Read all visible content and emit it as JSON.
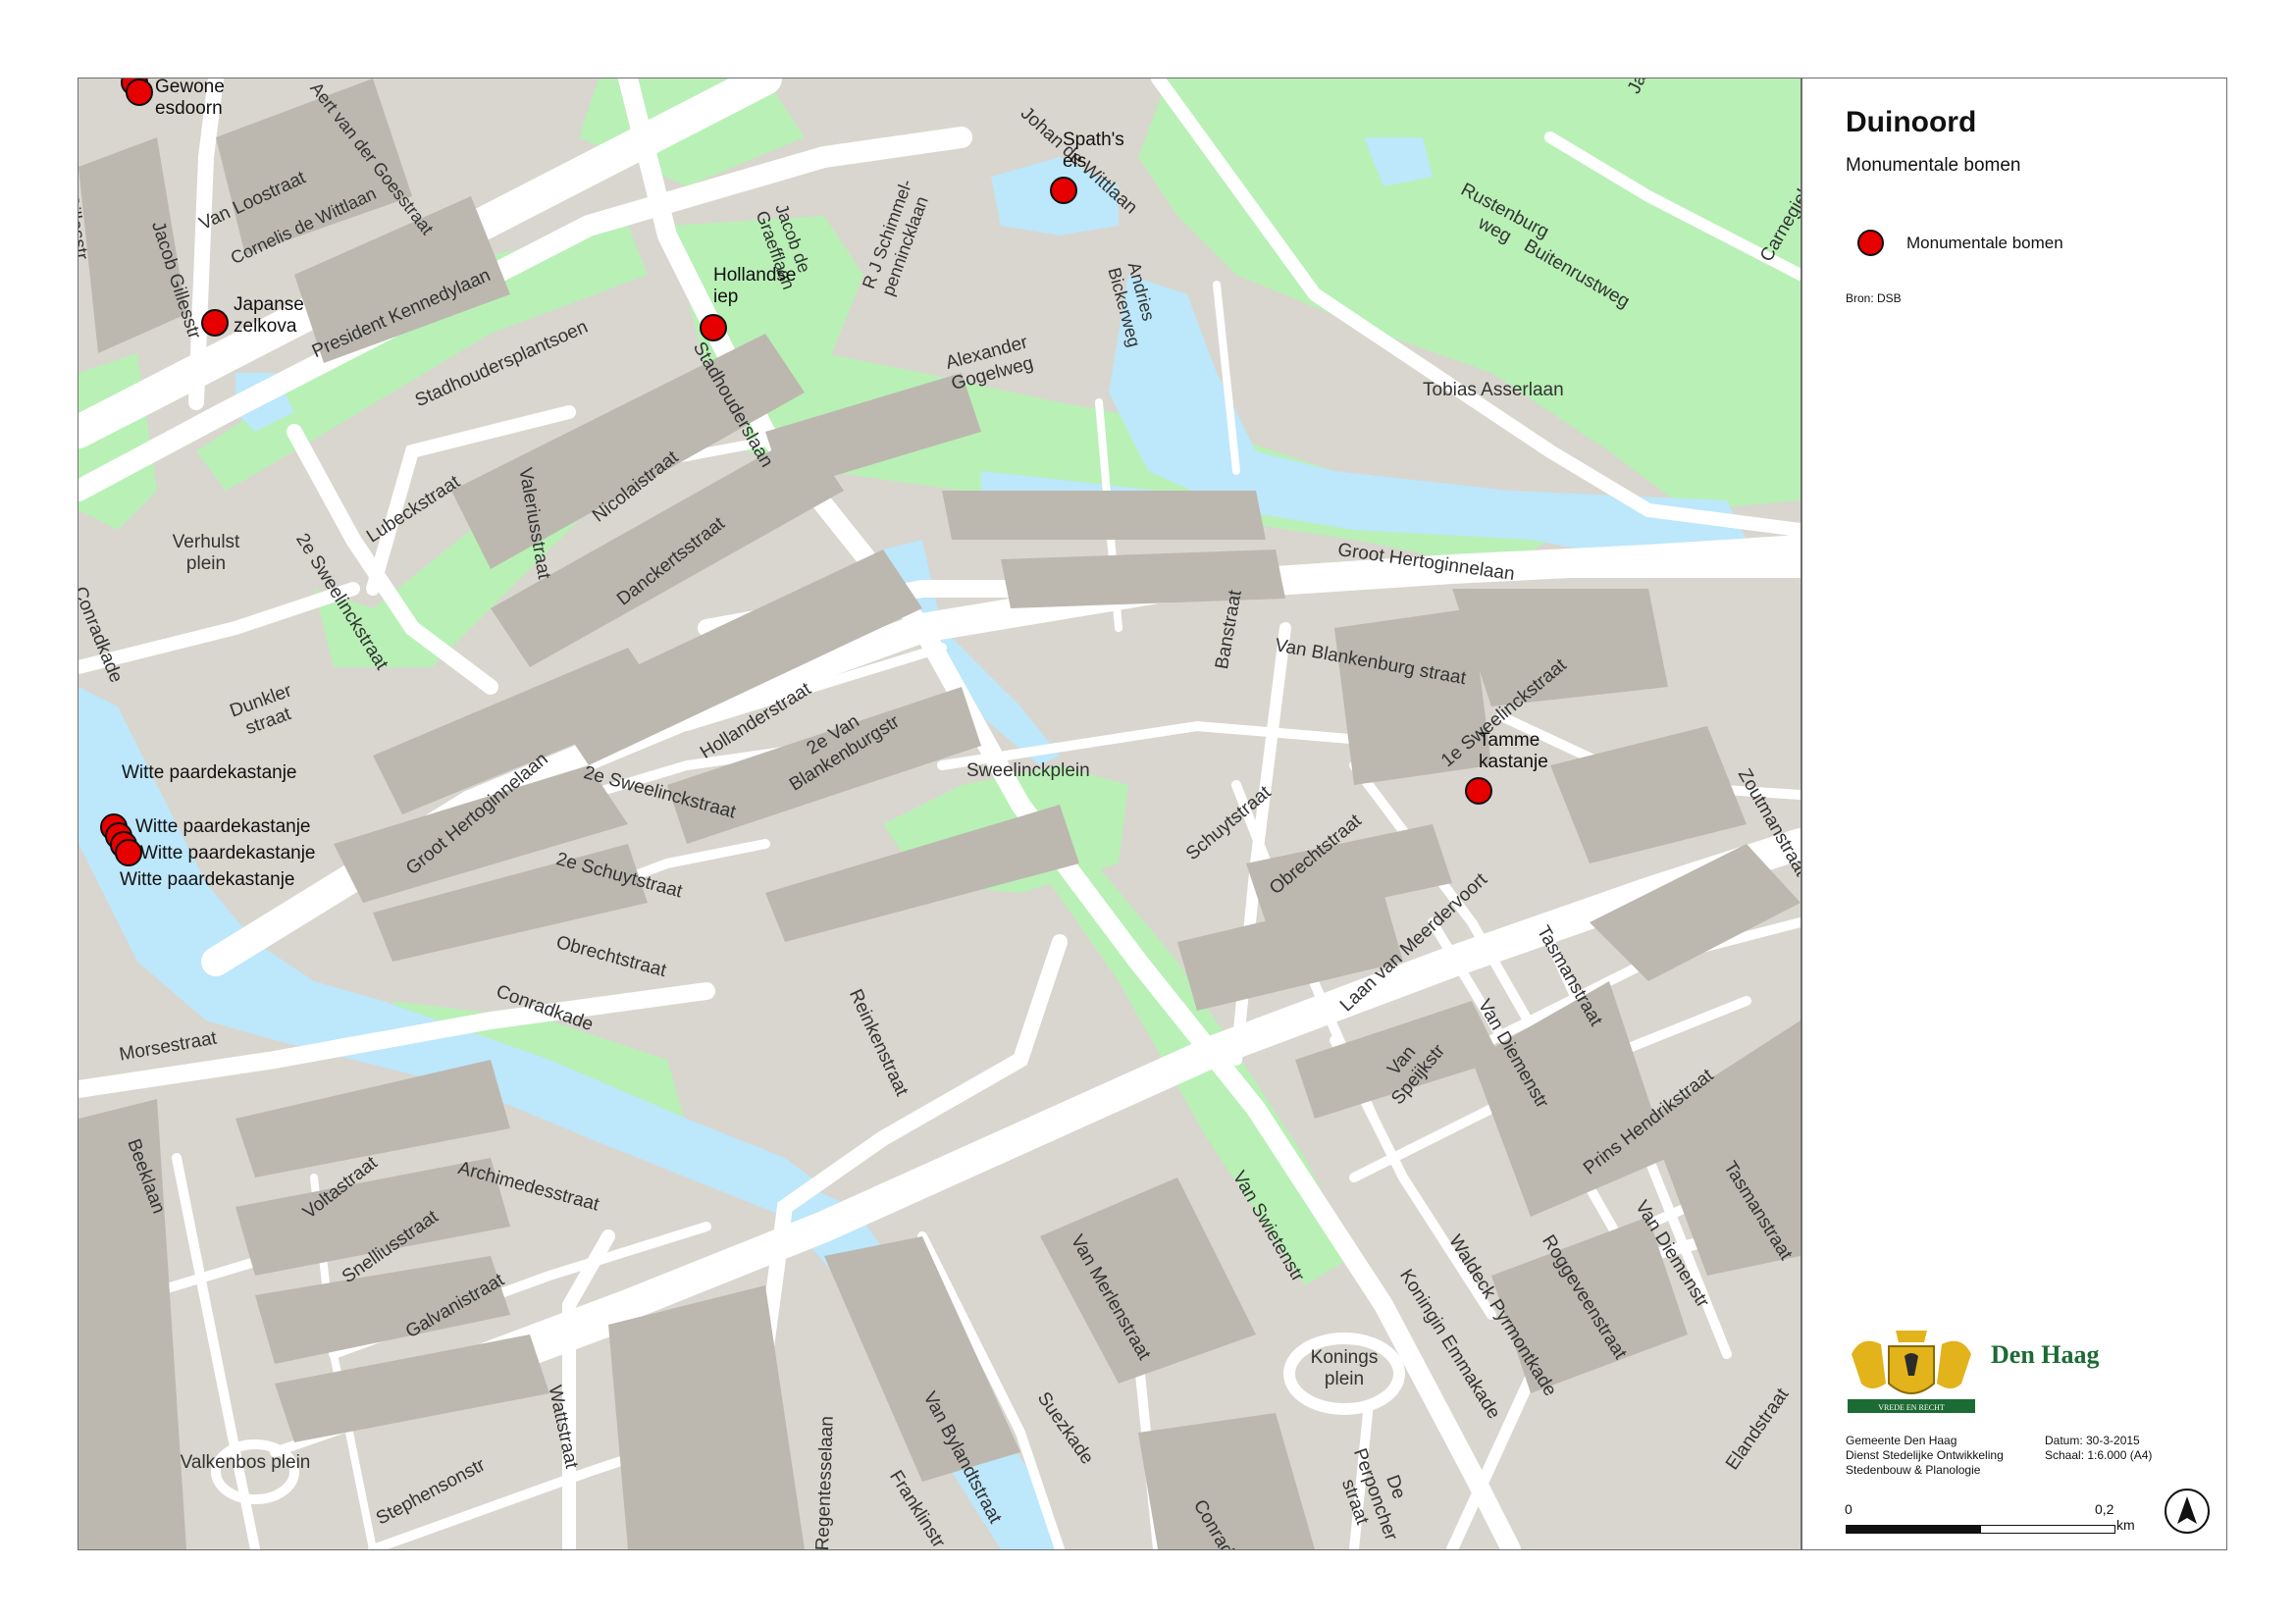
{
  "map": {
    "title": "Duinoord",
    "subtitle": "Monumentale bomen",
    "legend_label": "Monumentale bomen",
    "source": "Bron: DSB",
    "brand": "Den Haag",
    "logo_banner": "VREDE EN RECHT",
    "info": {
      "org1": "Gemeente Den Haag",
      "org2": "Dienst Stedelijke Ontwikkeling",
      "org3": "Stedenbouw & Planologie",
      "date": "Datum: 30-3-2015",
      "scale": "Schaal: 1:6.000 (A4)"
    },
    "scalebar": {
      "start": "0",
      "end": "0,2",
      "unit": "km"
    },
    "colors": {
      "tree": "#e60000",
      "park": "#b9f0b6",
      "water": "#bde7fa",
      "block": "#bcb8b0",
      "road": "#ffffff"
    }
  },
  "trees": [
    {
      "name": "Gewone esdoorn"
    },
    {
      "name": "Japanse zelkova"
    },
    {
      "name": "Hollandse iep"
    },
    {
      "name": "Spath's els"
    },
    {
      "name": "Tamme kastanje"
    },
    {
      "name": "Witte paardekastanje"
    },
    {
      "name": "Witte paardekastanje"
    },
    {
      "name": "Witte paardekastanje"
    },
    {
      "name": "Witte paardekastanje"
    }
  ],
  "streets": {
    "s1": "Van Loostraat",
    "s2": "Aert van der Goesstraat",
    "s3": "Cornelis de Wittlaan",
    "s4": "Jacob Gillesstr",
    "s5": "President Kennedylaan",
    "s6": "Stadhoudersplantsoen",
    "s7": "Stadhouderslaan",
    "s8": "Jacob de Graefflaan",
    "s9": "R J Schimmel- pennincklaan",
    "s10": "Johan de Wittlaan",
    "s11": "Andries Bickerweg",
    "s12": "Alexander Gogelweg",
    "s13": "Rustenburg weg",
    "s14": "Buitenrustweg",
    "s15": "Tobias Asserlaan",
    "s16": "Verhulst plein",
    "s17": "Lubeckstraat",
    "s18": "2e Sweelinckstraat",
    "s19": "Valeriusstraat",
    "s20": "Nicolaistraat",
    "s21": "Danckertsstraat",
    "s22": "Conradkade",
    "s23": "Groot Hertoginnelaan",
    "s24": "Banstraat",
    "s25": "Van Blankenburg straat",
    "s26": "1e Sweelinckstraat",
    "s27": "Hollanderstraat",
    "s28": "2e Van Blankenburgstr",
    "s29": "Sweelinckplein",
    "s30": "Dunkler straat",
    "s31": "Groot Hertoginnelaan",
    "s32": "2e Sweelinckstraat",
    "s33": "2e Schuytstraat",
    "s34": "Schuytstraat",
    "s35": "Obrechtstraat",
    "s36": "Obrechtstraat",
    "s37": "Laan van Meerdervoort",
    "s38": "Conradkade",
    "s39": "Reinkenstraat",
    "s40": "Morsestraat",
    "s41": "Beeklaan",
    "s42": "Voltastraat",
    "s43": "Archimedesstraat",
    "s44": "Snelliusstraat",
    "s45": "Galvanistraat",
    "s46": "Tasmanstraat",
    "s47": "Van Diemenstr",
    "s48": "Van Speijkstr",
    "s49": "Prins Hendrikstraat",
    "s50": "Roggeveenstraat",
    "s51": "Van Diemenstr",
    "s52": "Tasmanstraat",
    "s53": "Van Swietenstr",
    "s54": "Van Merlenstraat",
    "s55": "Waldeck Pyrmontkade",
    "s56": "Koningin Emmakade",
    "s57": "Konings plein",
    "s58": "De Perponcher straat",
    "s59": "Valkenbos plein",
    "s60": "Wattstraat",
    "s61": "Stephensonstr",
    "s62": "Van Bylandtstraat",
    "s63": "Suezkade",
    "s64": "Regentesselaan",
    "s65": "Franklinstr",
    "s66": "Zoutmanstraat",
    "s67": "Carnegielaan",
    "s68": "Elandstraat",
    "s69": "Jacob",
    "s70": "Conradkade",
    "s71": "Jacob Gillesstr"
  }
}
